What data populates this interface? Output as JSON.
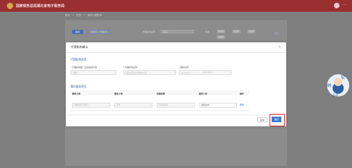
{
  "app": {
    "title": "国家税务总局湖北省电子税务局",
    "more": "···"
  },
  "breadcrumb": [
    "首页",
    "首页",
    "我的代理机构"
  ],
  "background": {
    "buttons": [
      "新增",
      "批量导入代理机构"
    ],
    "filters": {
      "label1": "代理机构名称",
      "input1": "请输入",
      "label2": "状态",
      "chips": [
        "请选择",
        "请选择",
        "请选择",
        "请选择"
      ]
    },
    "link": "查询"
  },
  "dialog": {
    "title": "代理机构确认",
    "close": "×",
    "section1": "代理机构信息",
    "fields": {
      "credit_code_label": "* 代理机构统一社会信用代码",
      "credit_code_placeholder": "请输入",
      "name_label": "* 代理机构名称",
      "name_placeholder": "将自动获取代理机构名称",
      "period_label": "* 服务时间",
      "date_from": "2024-04-11",
      "date_sep": "—",
      "date_to": "2025-04-11"
    },
    "section2": "委托服务项目",
    "table": {
      "headers": [
        "服务大类",
        "服务小类",
        "功能权限",
        "服务人员",
        "操作"
      ],
      "row": {
        "major": "申报纳税代理服务",
        "minor": "全部",
        "permission": "查看及办理",
        "staff_tag": "陶某(414)",
        "action": "删除"
      }
    },
    "buttons": {
      "cancel": "取消",
      "ok": "确定"
    }
  },
  "mascot": {
    "text_top": "征",
    "text_mid": "纳",
    "text_bottom": "互动"
  }
}
